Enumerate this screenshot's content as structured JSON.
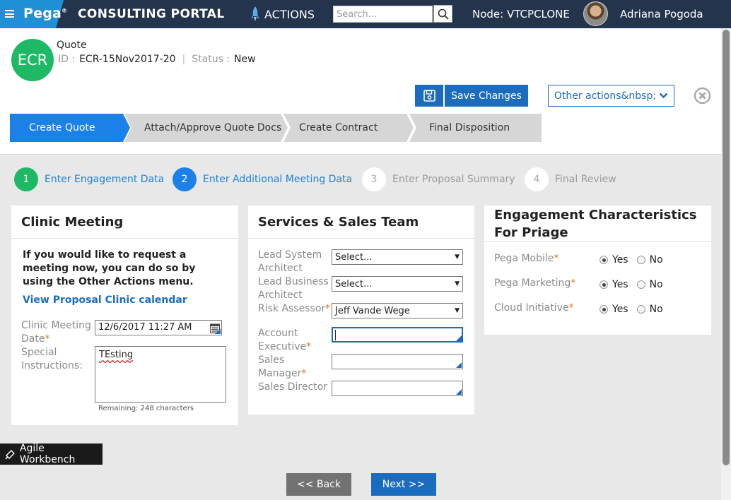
{
  "topnav": {
    "brand": "Pega",
    "app_title": "CONSULTING PORTAL",
    "actions_label": "ACTIONS",
    "search_placeholder": "Search...",
    "node_label": "Node:",
    "node_value": "VTCPCLONE",
    "user_name": "Adriana Pogoda"
  },
  "case": {
    "badge": "ECR",
    "type": "Quote",
    "id_label": "ID :",
    "id_value": "ECR-15Nov2017-20",
    "status_label": "Status :",
    "status_value": "New"
  },
  "header_actions": {
    "save_label": "Save Changes",
    "other_actions_label": "Other actions&nbsp;"
  },
  "stages": [
    "Create Quote",
    "Attach/Approve Quote Docs",
    "Create Contract",
    "Final Disposition"
  ],
  "steps": [
    {
      "number": "1",
      "label": "Enter Engagement Data"
    },
    {
      "number": "2",
      "label": "Enter Additional Meeting Data"
    },
    {
      "number": "3",
      "label": "Enter Proposal Summary"
    },
    {
      "number": "4",
      "label": "Final Review"
    }
  ],
  "clinic": {
    "title": "Clinic Meeting",
    "intro": "If you would like to request a meeting now, you can do so by using the Other Actions menu.",
    "calendar_link": "View Proposal Clinic calendar",
    "date_label": "Clinic Meeting Date",
    "date_value": "12/6/2017 11:27 AM",
    "instructions_label": "Special Instructions:",
    "instructions_value": "TEsting",
    "remaining": "Remaining: 248 characters"
  },
  "team": {
    "title": "Services & Sales Team",
    "lead_system_label": "Lead System Architect",
    "lead_system_value": "Select...",
    "lead_business_label": "Lead Business Architect",
    "lead_business_value": "Select...",
    "risk_label": "Risk Assessor",
    "risk_value": "Jeff Vande Wege",
    "account_exec_label": "Account Executive",
    "sales_manager_label": "Sales Manager",
    "sales_director_label": "Sales Director"
  },
  "engagement": {
    "title": "Engagement Characteristics For Priage",
    "rows": [
      {
        "label": "Pega Mobile",
        "selected": "Yes"
      },
      {
        "label": "Pega Marketing",
        "selected": "Yes"
      },
      {
        "label": "Cloud Initiative",
        "selected": "Yes"
      }
    ],
    "yes_label": "Yes",
    "no_label": "No"
  },
  "footer": {
    "back_label": "<< Back",
    "next_label": "Next >>",
    "workbench_label": "Agile Workbench"
  },
  "colors": {
    "nav_bg": "#23344c",
    "brand_blue": "#1f8fd6",
    "primary": "#1b6cbf",
    "stage_active": "#1b80e8",
    "step_done": "#1db965",
    "required": "#e07a1f"
  }
}
